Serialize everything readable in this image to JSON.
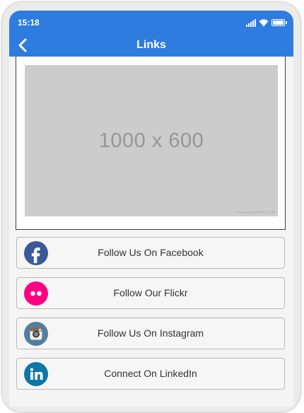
{
  "status_bar": {
    "time": "15:18"
  },
  "header": {
    "title": "Links"
  },
  "banner": {
    "placeholder_text": "1000 x 600",
    "credit_text": "Powered by HTML.COM"
  },
  "links": [
    {
      "label": "Follow Us On Facebook",
      "icon": "facebook-icon",
      "color": "#3b5998"
    },
    {
      "label": "Follow Our Flickr",
      "icon": "flickr-icon",
      "color": "#ff0084"
    },
    {
      "label": "Follow Us On Instagram",
      "icon": "instagram-icon",
      "color": "#517fa4"
    },
    {
      "label": "Connect On LinkedIn",
      "icon": "linkedin-icon",
      "color": "#0e76a8"
    }
  ],
  "colors": {
    "primary": "#2f7ce0"
  }
}
